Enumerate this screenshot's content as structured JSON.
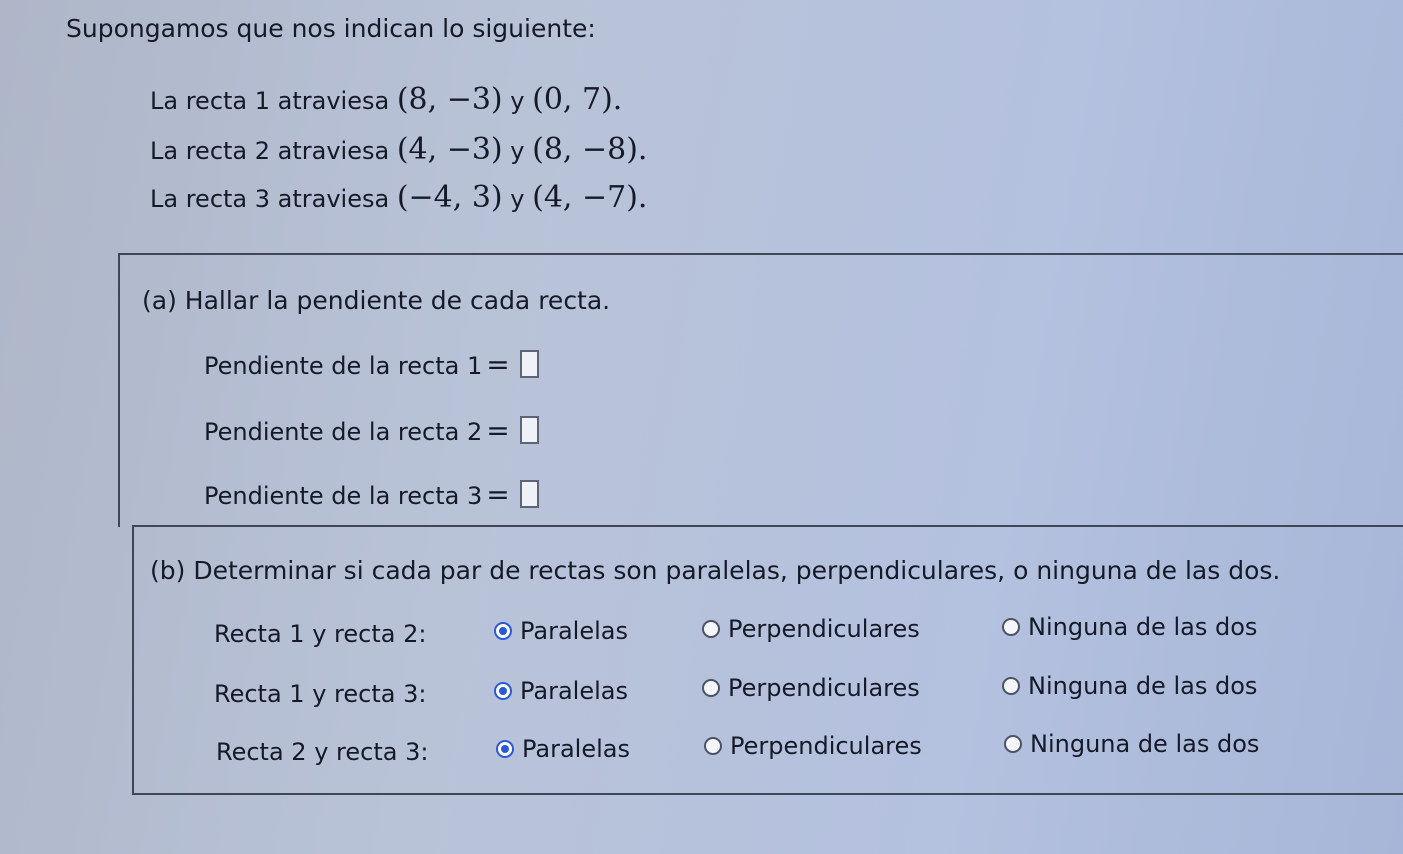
{
  "intro": "Supongamos que nos indican lo siguiente:",
  "lines": [
    {
      "prefix": "La recta 1 atraviesa",
      "p1": "(8, −3)",
      "conj": "y",
      "p2": "(0, 7)."
    },
    {
      "prefix": "La recta 2 atraviesa",
      "p1": "(4, −3)",
      "conj": "y",
      "p2": "(8, −8)."
    },
    {
      "prefix": "La recta 3 atraviesa",
      "p1": "(−4, 3)",
      "conj": "y",
      "p2": "(4, −7)."
    }
  ],
  "part_a": {
    "title": "(a) Hallar la pendiente de cada recta.",
    "rows": [
      {
        "label": "Pendiente de la recta 1",
        "eq": "=",
        "value": ""
      },
      {
        "label": "Pendiente de la recta 2",
        "eq": "=",
        "value": ""
      },
      {
        "label": "Pendiente de la recta 3",
        "eq": "=",
        "value": ""
      }
    ]
  },
  "part_b": {
    "title": "(b) Determinar si cada par de rectas son paralelas, perpendiculares, o ninguna de las dos.",
    "options": [
      "Paralelas",
      "Perpendiculares",
      "Ninguna de las dos"
    ],
    "pairs": [
      {
        "label": "Recta 1 y recta 2:",
        "selected": "Paralelas"
      },
      {
        "label": "Recta 1 y recta 3:",
        "selected": "Paralelas"
      },
      {
        "label": "Recta 2 y recta 3:",
        "selected": "Paralelas"
      }
    ]
  },
  "colors": {
    "accent": "#2a58d9",
    "text": "#151a28",
    "border": "#3f4656"
  }
}
